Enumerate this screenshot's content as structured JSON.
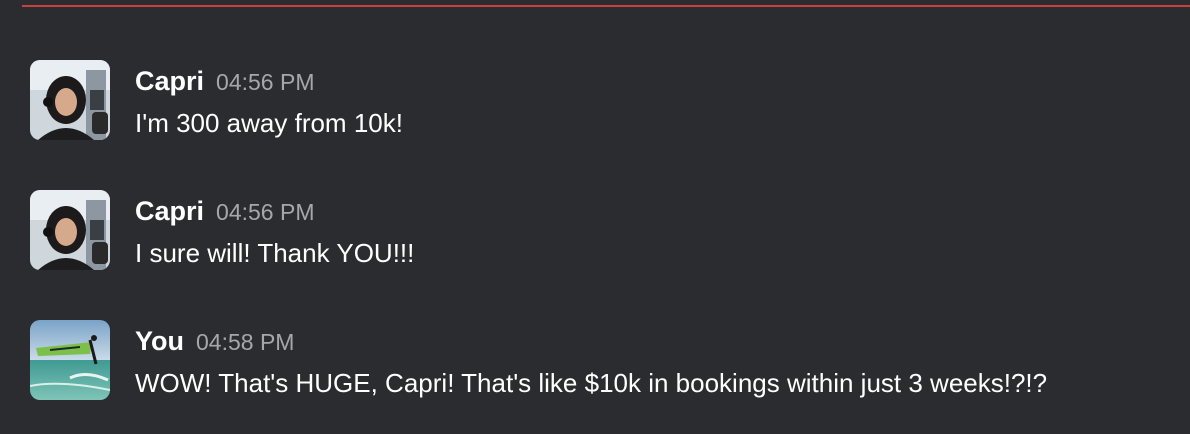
{
  "colors": {
    "background": "#2b2c30",
    "divider": "#c8423d",
    "timestamp": "#a6a7ab",
    "text": "#ffffff"
  },
  "messages": [
    {
      "sender": "Capri",
      "time": "04:56 PM",
      "text": "I'm 300 away from 10k!",
      "avatar": "user-photo-icon"
    },
    {
      "sender": "Capri",
      "time": "04:56 PM",
      "text": "I sure will! Thank YOU!!!",
      "avatar": "user-photo-icon"
    },
    {
      "sender": "You",
      "time": "04:58 PM",
      "text": "WOW! That's HUGE, Capri! That's like $10k in bookings within just 3 weeks!?!?",
      "avatar": "windsurf-photo-icon"
    }
  ]
}
